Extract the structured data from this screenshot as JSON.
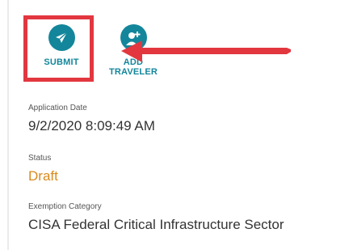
{
  "actions": {
    "submit": {
      "label": "SUBMIT",
      "icon": "paper-plane-icon"
    },
    "add_traveler": {
      "label_line1": "ADD",
      "label_line2": "TRAVELER",
      "icon": "add-person-icon"
    }
  },
  "fields": {
    "application_date": {
      "label": "Application Date",
      "value": "9/2/2020 8:09:49 AM"
    },
    "status": {
      "label": "Status",
      "value": "Draft"
    },
    "exemption_category": {
      "label": "Exemption Category",
      "value": "CISA Federal Critical Infrastructure Sector"
    }
  },
  "colors": {
    "accent": "#13869b",
    "highlight": "#e2373f",
    "status_draft": "#d98a1c",
    "text": "#333333"
  }
}
